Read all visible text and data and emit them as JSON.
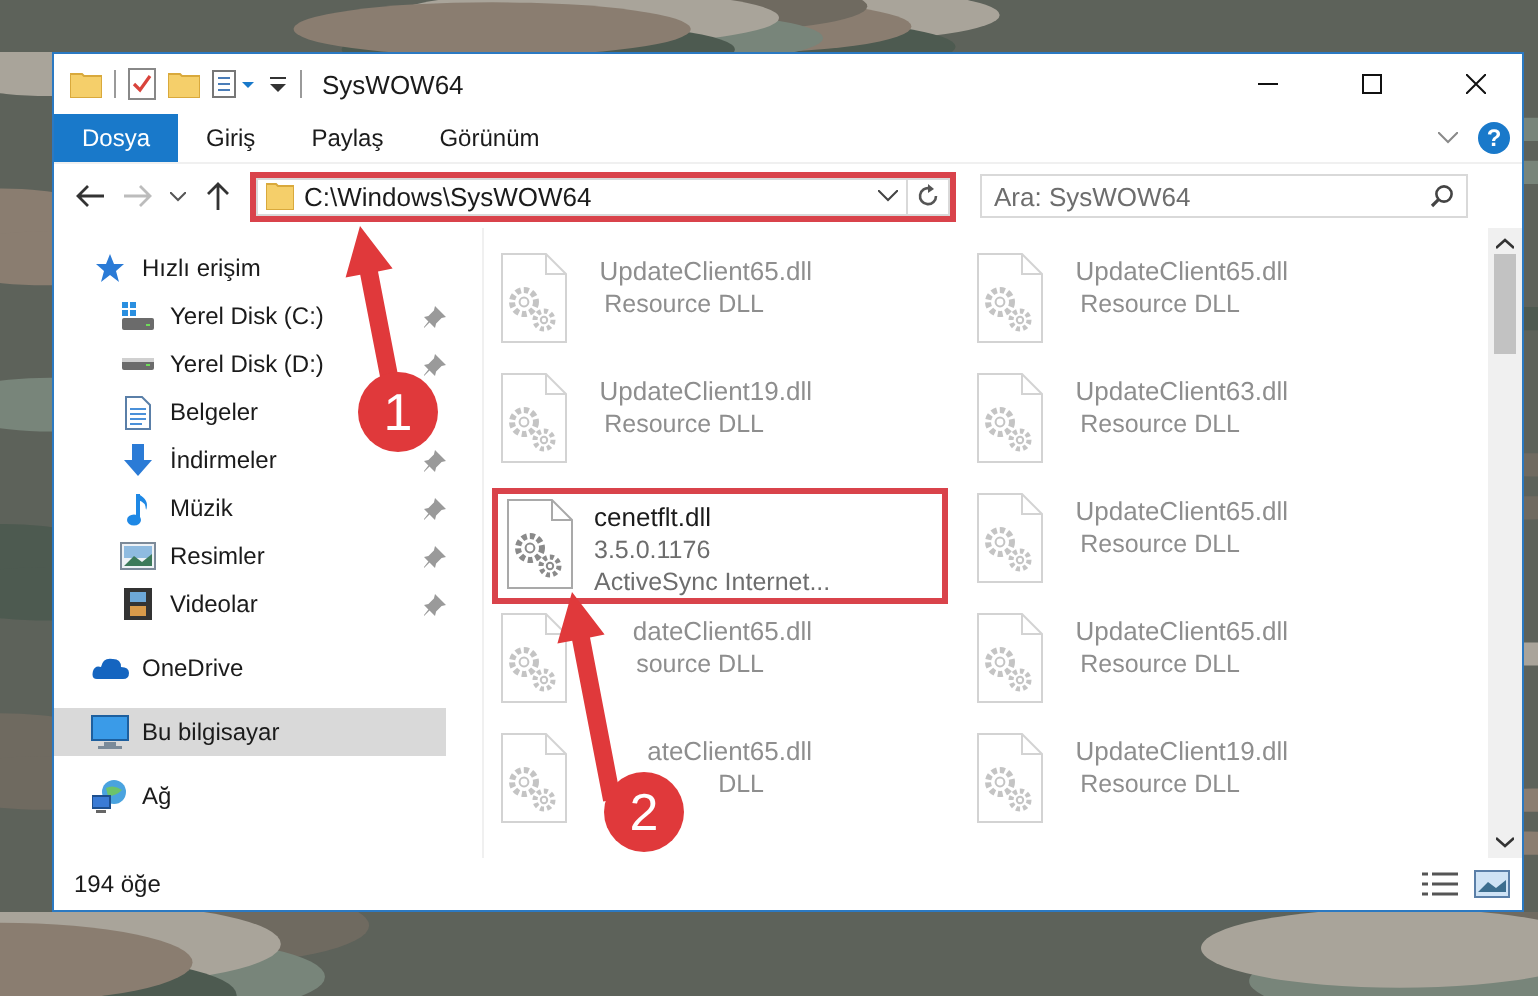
{
  "window": {
    "title": "SysWOW64"
  },
  "ribbon": {
    "tabs": [
      {
        "label": "Dosya",
        "selected": true
      },
      {
        "label": "Giriş",
        "selected": false
      },
      {
        "label": "Paylaş",
        "selected": false
      },
      {
        "label": "Görünüm",
        "selected": false
      }
    ],
    "help": "?"
  },
  "address": {
    "path": "C:\\Windows\\SysWOW64",
    "highlighted": true
  },
  "search": {
    "placeholder": "Ara: SysWOW64"
  },
  "sidebar": {
    "items": [
      {
        "label": "Hızlı erişim",
        "kind": "star",
        "selected": false,
        "children": [
          {
            "label": "Yerel Disk (C:)",
            "kind": "sysdrive",
            "pinned": true
          },
          {
            "label": "Yerel Disk (D:)",
            "kind": "drive",
            "pinned": true
          },
          {
            "label": "Belgeler",
            "kind": "documents",
            "pinned": false
          },
          {
            "label": "İndirmeler",
            "kind": "downloads",
            "pinned": true
          },
          {
            "label": "Müzik",
            "kind": "music",
            "pinned": true
          },
          {
            "label": "Resimler",
            "kind": "pictures",
            "pinned": true
          },
          {
            "label": "Videolar",
            "kind": "videos",
            "pinned": true
          }
        ]
      },
      {
        "label": "OneDrive",
        "kind": "cloud",
        "selected": false
      },
      {
        "label": "Bu bilgisayar",
        "kind": "computer",
        "selected": true
      },
      {
        "label": "Ağ",
        "kind": "network",
        "selected": false
      }
    ]
  },
  "files": [
    {
      "name": "UpdateClient65.dll",
      "lines": [
        "Resource DLL"
      ],
      "dimmed": true,
      "highlighted": false
    },
    {
      "name": "UpdateClient65.dll",
      "lines": [
        "Resource DLL"
      ],
      "dimmed": true,
      "highlighted": false
    },
    {
      "name": "UpdateClient19.dll",
      "lines": [
        "Resource DLL"
      ],
      "dimmed": true,
      "highlighted": false
    },
    {
      "name": "UpdateClient63.dll",
      "lines": [
        "Resource DLL"
      ],
      "dimmed": true,
      "highlighted": false
    },
    {
      "name": "cenetflt.dll",
      "lines": [
        "3.5.0.1176",
        "ActiveSync Internet..."
      ],
      "dimmed": false,
      "highlighted": true
    },
    {
      "name": "UpdateClient65.dll",
      "lines": [
        "Resource DLL"
      ],
      "dimmed": true,
      "highlighted": false
    },
    {
      "name": "dateClient65.dll",
      "lines": [
        "source DLL"
      ],
      "dimmed": true,
      "highlighted": false
    },
    {
      "name": "UpdateClient65.dll",
      "lines": [
        "Resource DLL"
      ],
      "dimmed": true,
      "highlighted": false
    },
    {
      "name": "ateClient65.dll",
      "lines": [
        "DLL"
      ],
      "dimmed": true,
      "highlighted": false
    },
    {
      "name": "UpdateClient19.dll",
      "lines": [
        "Resource DLL"
      ],
      "dimmed": true,
      "highlighted": false
    }
  ],
  "status_bar": {
    "item_count": "194 öğe"
  },
  "annotations": {
    "markers": [
      {
        "label": "1"
      },
      {
        "label": "2"
      }
    ]
  }
}
